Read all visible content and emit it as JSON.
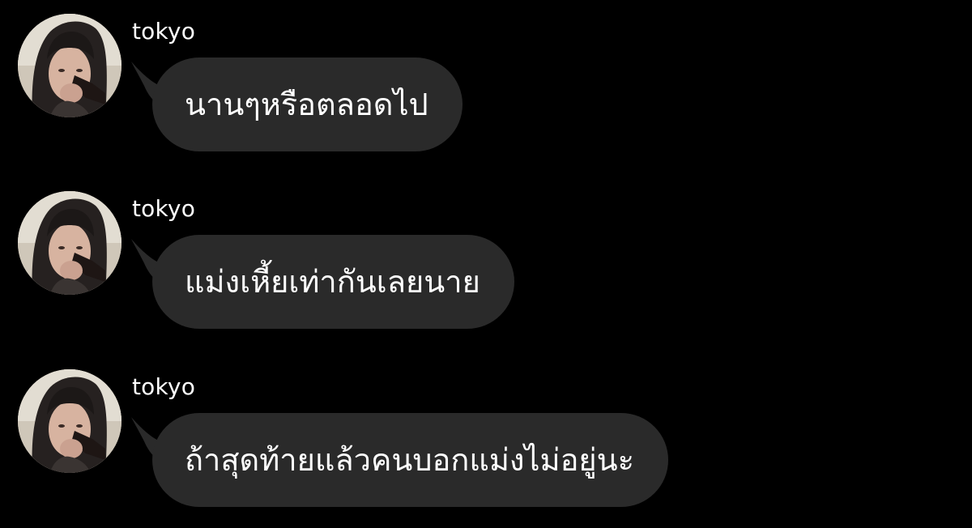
{
  "colors": {
    "background": "#000000",
    "bubble": "#2a2a2a",
    "text": "#ffffff"
  },
  "messages": [
    {
      "username": "tokyo",
      "text": "นานๆหรือตลอดไป",
      "avatar_icon": "profile-photo"
    },
    {
      "username": "tokyo",
      "text": "แม่งเหี้ยเท่ากันเลยนาย",
      "avatar_icon": "profile-photo"
    },
    {
      "username": "tokyo",
      "text": "ถ้าสุดท้ายแล้วคนบอกแม่งไม่อยู่นะ",
      "avatar_icon": "profile-photo"
    }
  ]
}
